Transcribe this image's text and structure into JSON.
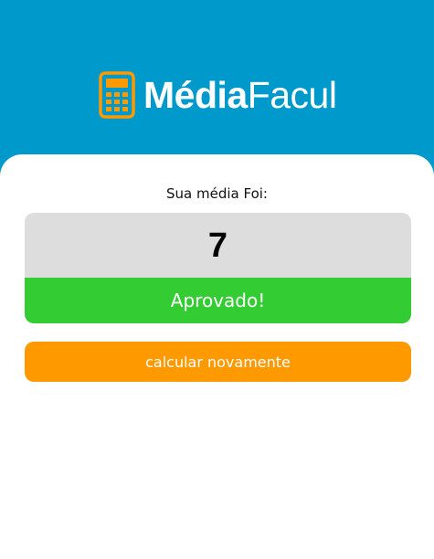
{
  "header": {
    "brand_bold": "Média",
    "brand_light": "Facul",
    "logo_icon": "calculator-icon",
    "background_color": "#0099cc"
  },
  "result": {
    "label": "Sua média Foi:",
    "grade": "7",
    "status": "Aprovado!",
    "status_color": "#33cc33"
  },
  "actions": {
    "recalculate_label": "calcular novamente",
    "button_color": "#ff9900"
  }
}
